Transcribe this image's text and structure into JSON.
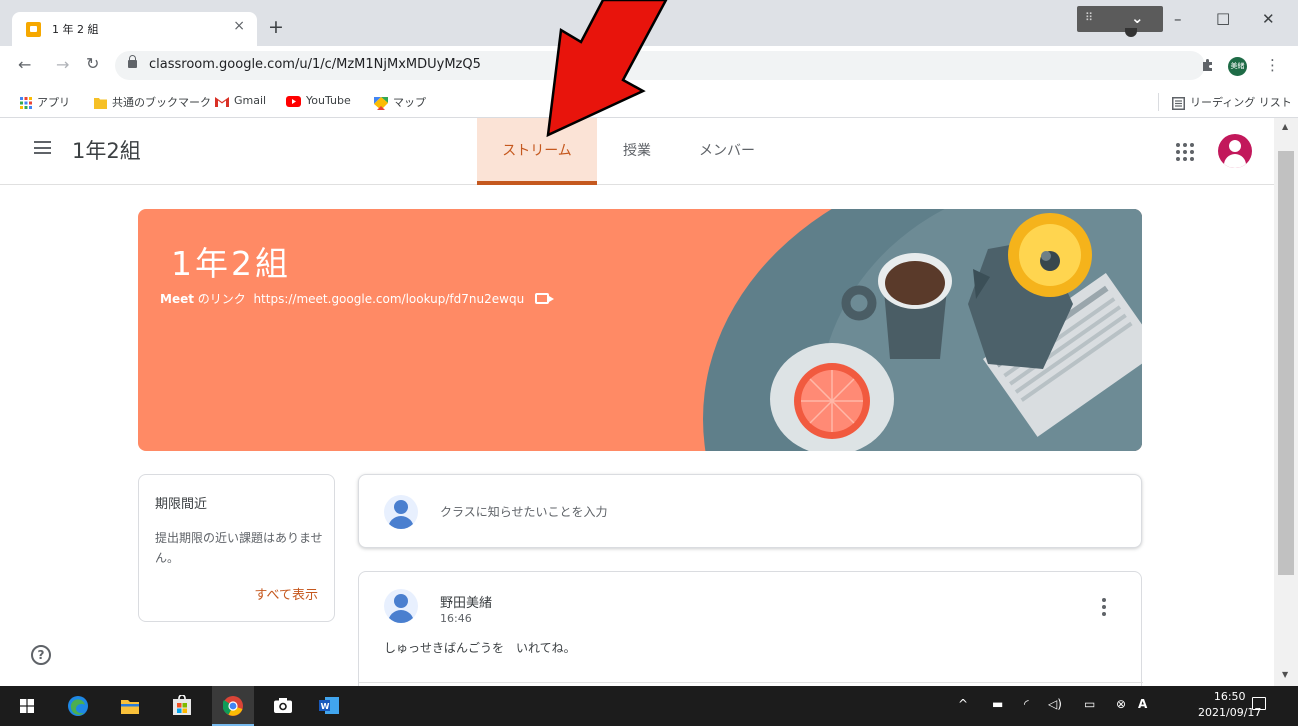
{
  "browser": {
    "tab_title": "1 年 2 組",
    "tab_close": "×",
    "new_tab": "+",
    "url": "classroom.google.com/u/1/c/MzM1NjMxMDUyMzQ5",
    "profile_initials": "美緒",
    "window_minimize": "–",
    "window_maximize": "□",
    "window_close": "✕"
  },
  "bookmarks": {
    "items": [
      {
        "label": "アプリ",
        "icon": "apps-grid-icon"
      },
      {
        "label": "共通のブックマーク",
        "icon": "folder-icon"
      },
      {
        "label": "Gmail",
        "icon": "gmail-icon"
      },
      {
        "label": "YouTube",
        "icon": "youtube-icon"
      },
      {
        "label": "マップ",
        "icon": "maps-icon"
      }
    ],
    "reading_list": "リーディング リスト"
  },
  "classroom": {
    "class_name": "1年2組",
    "tabs": [
      {
        "label": "ストリーム",
        "active": true
      },
      {
        "label": "授業",
        "active": false
      },
      {
        "label": "メンバー",
        "active": false
      }
    ],
    "banner": {
      "title": "1年2組",
      "meet_label": "Meet",
      "meet_suffix": "のリンク",
      "meet_url": "https://meet.google.com/lookup/fd7nu2ewqu",
      "color": "#ff8a65"
    },
    "upcoming": {
      "title": "期限間近",
      "text": "提出期限の近い課題はありません。",
      "view_all": "すべて表示"
    },
    "composer": {
      "placeholder": "クラスに知らせたいことを入力"
    },
    "posts": [
      {
        "author": "野田美緒",
        "time": "16:46",
        "body": "しゅっせきばんごうを　いれてね。"
      }
    ],
    "help": "?"
  },
  "colors": {
    "accent": "#c5581e",
    "tab_active_bg": "#fbe3d6",
    "annotation_arrow": "#e8140c"
  },
  "taskbar": {
    "time": "16:50",
    "date": "2021/09/17",
    "apps": [
      "windows-start-icon",
      "edge-icon",
      "file-explorer-icon",
      "store-icon",
      "chrome-icon",
      "camera-icon",
      "word-icon"
    ]
  }
}
